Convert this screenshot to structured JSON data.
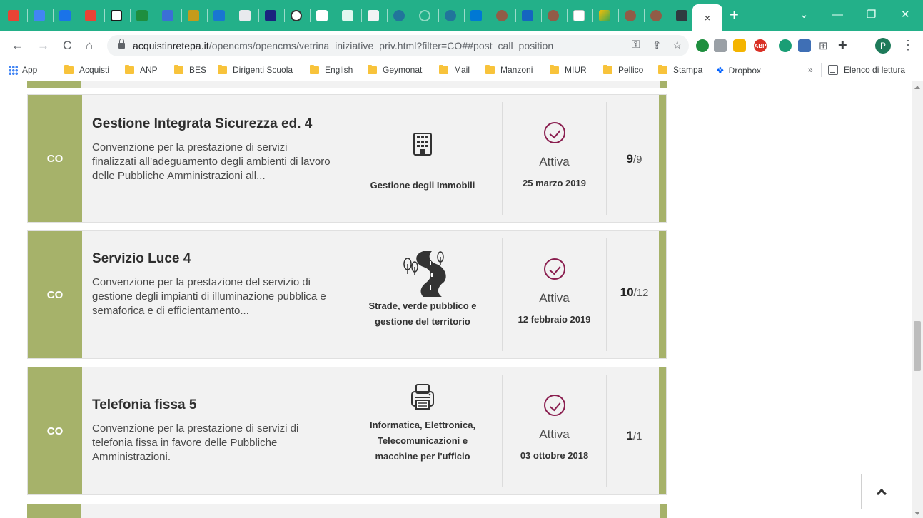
{
  "browser": {
    "tab_close": "×",
    "new_tab": "+",
    "window_controls": {
      "chevron": "⌄",
      "minimize": "—",
      "restore": "❐",
      "close": "✕"
    },
    "nav": {
      "back": "←",
      "forward": "→",
      "reload": "C",
      "home": "⌂"
    },
    "url_host": "acquistinretepa.it",
    "url_path": "/opencms/opencms/vetrina_iniziative_priv.html?filter=CO##post_call_position",
    "profile_initial": "P",
    "ext_badge": "ABP"
  },
  "bookmarks": {
    "apps": "App",
    "items": [
      "Acquisti",
      "ANP",
      "BES",
      "Dirigenti Scuola",
      "English",
      "Geymonat",
      "Mail",
      "Manzoni",
      "MIUR",
      "Pellico",
      "Stampa"
    ],
    "dropbox": "Dropbox",
    "more": "»",
    "reading_list": "Elenco di lettura"
  },
  "cards": [
    {
      "tag": "CO",
      "title": "Gestione Integrata Sicurezza ed. 4",
      "desc": "Convenzione per la prestazione di servizi finalizzati all’adeguamento degli ambienti di lavoro delle Pubbliche Amministrazioni all...",
      "category": "Gestione degli Immobili",
      "status": "Attiva",
      "date": "25 marzo 2019",
      "count_main": "9",
      "count_total": "/9"
    },
    {
      "tag": "CO",
      "title": "Servizio Luce 4",
      "desc": "Convenzione per la prestazione del servizio di gestione degli impianti di illuminazione pubblica e semaforica e di efficientamento...",
      "category_line1": "Strade, verde pubblico e",
      "category_line2": "gestione del territorio",
      "status": "Attiva",
      "date": "12 febbraio 2019",
      "count_main": "10",
      "count_total": "/12"
    },
    {
      "tag": "CO",
      "title": "Telefonia fissa 5",
      "desc": "Convenzione per la prestazione di servizi di telefonia fissa in favore delle Pubbliche Amministrazioni.",
      "category_line1": "Informatica, Elettronica,",
      "category_line2": "Telecomunicazioni e",
      "category_line3": "macchine per l'ufficio",
      "status": "Attiva",
      "date": "03 ottobre 2018",
      "count_main": "1",
      "count_total": "/1"
    }
  ]
}
